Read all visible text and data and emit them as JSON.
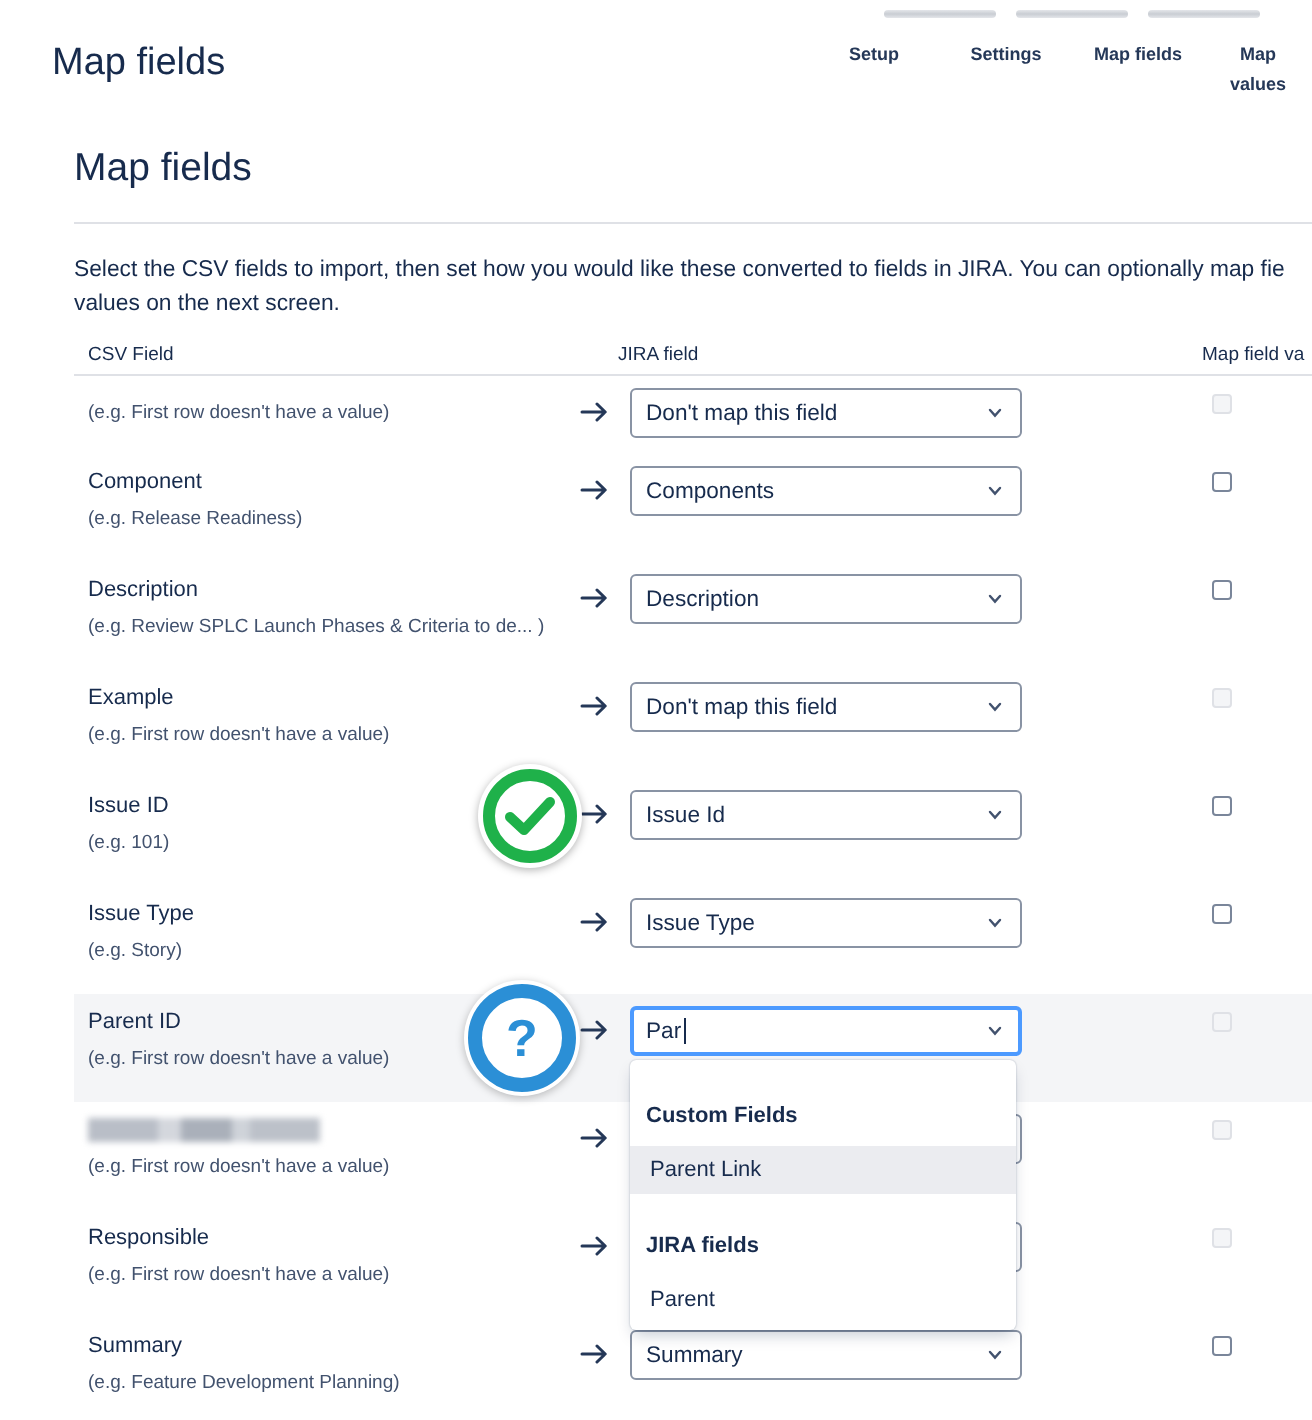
{
  "page_title": "Map fields",
  "steps": [
    {
      "label": "Setup"
    },
    {
      "label": "Settings"
    },
    {
      "label": "Map fields"
    },
    {
      "label": "Map values"
    }
  ],
  "section": {
    "title": "Map fields",
    "description": [
      "Select the CSV fields to import, then set how you would like these converted to fields in JIRA. You can optionally map fie",
      "values on the next screen."
    ]
  },
  "table": {
    "columns": [
      "CSV Field",
      "JIRA field",
      "Map field va"
    ],
    "rows": [
      {
        "sample": "(e.g. First row doesn't have a value)",
        "redacted": false,
        "select": {
          "value": "Don't map this field",
          "focused": false
        },
        "checkbox": {
          "checked": false,
          "disabled": true
        }
      },
      {
        "name": "Component",
        "sample": "(e.g. Release Readiness)",
        "redacted": false,
        "select": {
          "value": "Components",
          "focused": false
        },
        "checkbox": {
          "checked": false,
          "disabled": false
        }
      },
      {
        "name": "Description",
        "sample": "(e.g. Review SPLC Launch Phases & Criteria to de... )",
        "redacted": false,
        "select": {
          "value": "Description",
          "focused": false
        },
        "checkbox": {
          "checked": false,
          "disabled": false
        }
      },
      {
        "name": "Example",
        "sample": "(e.g. First row doesn't have a value)",
        "redacted": false,
        "select": {
          "value": "Don't map this field",
          "focused": false
        },
        "checkbox": {
          "checked": false,
          "disabled": true
        }
      },
      {
        "name": "Issue ID",
        "sample": "(e.g. 101)",
        "redacted": false,
        "select": {
          "value": "Issue Id",
          "focused": false
        },
        "checkbox": {
          "checked": false,
          "disabled": false
        },
        "badge": {
          "kind": "check"
        }
      },
      {
        "name": "Issue Type",
        "sample": "(e.g. Story)",
        "redacted": false,
        "select": {
          "value": "Issue Type",
          "focused": false
        },
        "checkbox": {
          "checked": false,
          "disabled": false
        }
      },
      {
        "name": "Parent ID",
        "sample": "(e.g. First row doesn't have a value)",
        "redacted": false,
        "select": {
          "value": "Par",
          "focused": true
        },
        "checkbox": {
          "checked": false,
          "disabled": true
        },
        "badge": {
          "kind": "question",
          "symbol": "?"
        },
        "menu": {
          "groups": [
            {
              "heading": "Custom Fields",
              "options": [
                {
                  "label": "Parent Link",
                  "selected": true
                }
              ]
            },
            {
              "heading": "JIRA fields",
              "options": [
                {
                  "label": "Parent",
                  "selected": false
                }
              ]
            }
          ]
        }
      },
      {
        "sample": "(e.g. First row doesn't have a value)",
        "redacted": true,
        "select": {
          "focused": false
        },
        "checkbox": {
          "checked": false,
          "disabled": true
        }
      },
      {
        "name": "Responsible",
        "sample": "(e.g. First row doesn't have a value)",
        "redacted": false,
        "select": {
          "focused": false
        },
        "checkbox": {
          "checked": false,
          "disabled": true
        }
      },
      {
        "name": "Summary",
        "sample": "(e.g. Feature Development Planning)",
        "redacted": false,
        "select": {
          "value": "Summary",
          "focused": false
        },
        "checkbox": {
          "checked": false,
          "disabled": false
        }
      }
    ]
  }
}
